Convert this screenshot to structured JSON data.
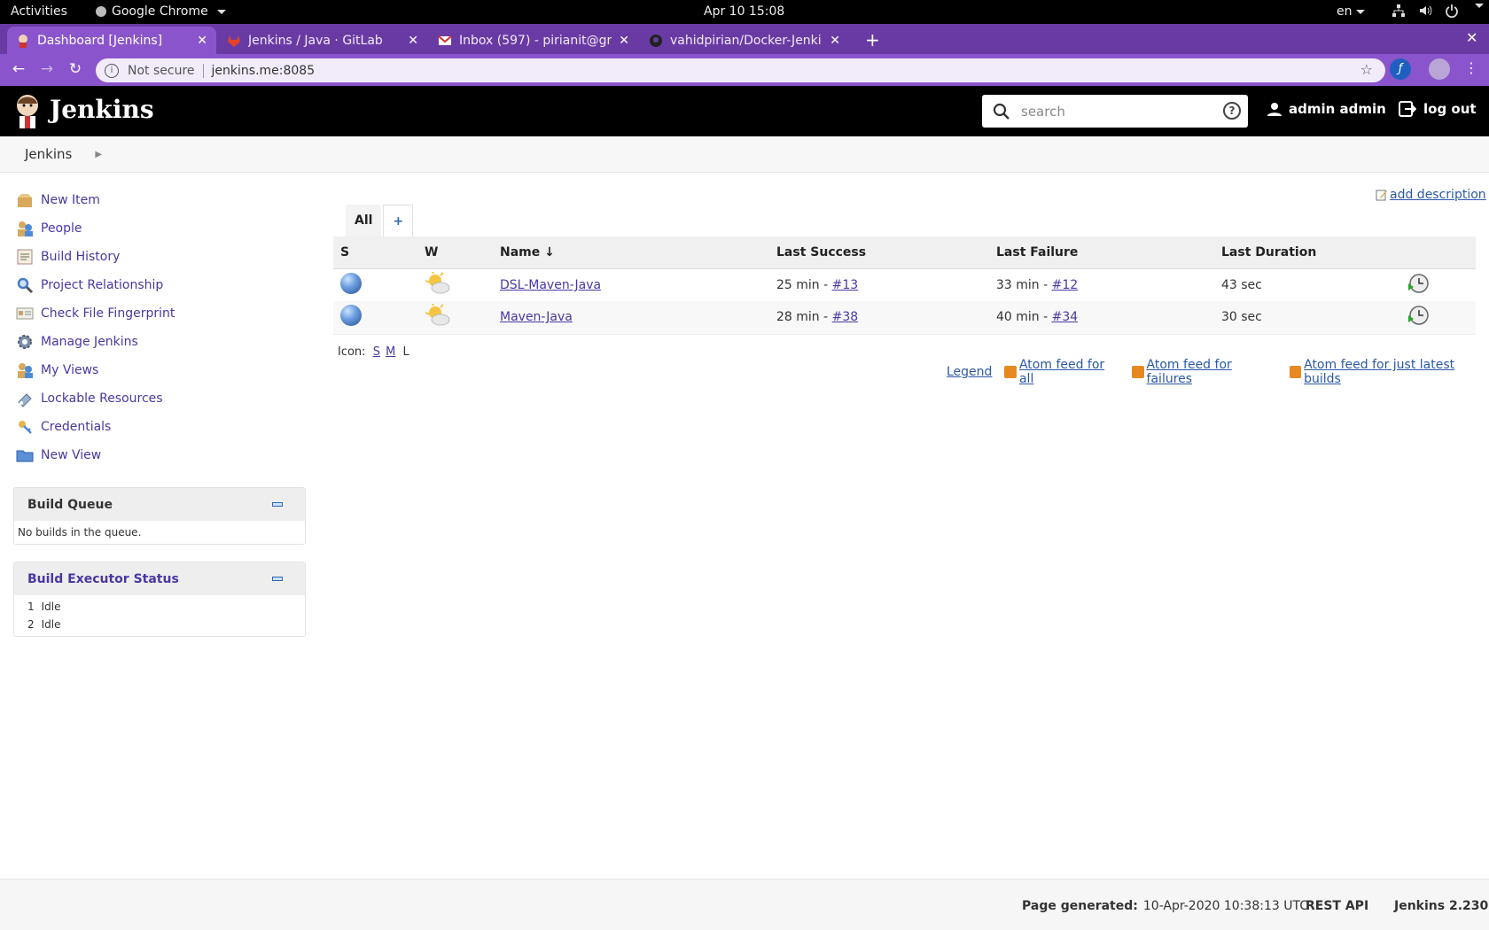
{
  "system_bar": {
    "activities": "Activities",
    "app_name": "Google Chrome",
    "clock": "Apr 10  15:08",
    "language": "en"
  },
  "browser": {
    "tabs": [
      {
        "title": "Dashboard [Jenkins]",
        "favicon": "jenkins-icon",
        "active": true
      },
      {
        "title": "Jenkins / Java · GitLab",
        "favicon": "gitlab-icon",
        "active": false
      },
      {
        "title": "Inbox (597) - pirianit@gm",
        "favicon": "gmail-icon",
        "active": false
      },
      {
        "title": "vahidpirian/Docker-Jenki",
        "favicon": "github-icon",
        "active": false
      }
    ],
    "new_tab": "+",
    "security_label": "Not secure",
    "url": "jenkins.me:8085"
  },
  "jenkins_header": {
    "brand": "Jenkins",
    "search_placeholder": "search",
    "user": "admin admin",
    "logout": "log out"
  },
  "breadcrumb": {
    "root": "Jenkins"
  },
  "side_tasks": [
    {
      "label": "New Item",
      "icon": "new-item-icon"
    },
    {
      "label": "People",
      "icon": "people-icon"
    },
    {
      "label": "Build History",
      "icon": "build-history-icon"
    },
    {
      "label": "Project Relationship",
      "icon": "search-icon"
    },
    {
      "label": "Check File Fingerprint",
      "icon": "fingerprint-icon"
    },
    {
      "label": "Manage Jenkins",
      "icon": "gear-icon"
    },
    {
      "label": "My Views",
      "icon": "people-icon"
    },
    {
      "label": "Lockable Resources",
      "icon": "lock-icon"
    },
    {
      "label": "Credentials",
      "icon": "key-icon"
    },
    {
      "label": "New View",
      "icon": "folder-icon"
    }
  ],
  "build_queue": {
    "title": "Build Queue",
    "empty_message": "No builds in the queue."
  },
  "executor_status": {
    "title": "Build Executor Status",
    "executors": [
      {
        "number": "1",
        "state": "Idle"
      },
      {
        "number": "2",
        "state": "Idle"
      }
    ]
  },
  "main": {
    "add_description": "add description",
    "view_tabs": {
      "all": "All",
      "add": "+"
    },
    "columns": {
      "status": "S",
      "weather": "W",
      "name": "Name",
      "sort_indicator": "↓",
      "last_success": "Last Success",
      "last_failure": "Last Failure",
      "last_duration": "Last Duration"
    },
    "jobs": [
      {
        "name": "DSL-Maven-Java",
        "success_time": "25 min - ",
        "success_build": "#13",
        "failure_time": "33 min - ",
        "failure_build": "#12",
        "duration": "43 sec",
        "status_color": "blue",
        "weather": "partly-sunny"
      },
      {
        "name": "Maven-Java",
        "success_time": "28 min - ",
        "success_build": "#38",
        "failure_time": "40 min - ",
        "failure_build": "#34",
        "duration": "30 sec",
        "status_color": "blue",
        "weather": "partly-sunny"
      }
    ],
    "icon_size": {
      "label": "Icon:",
      "small": "S",
      "medium": "M",
      "large": "L"
    },
    "legend": "Legend",
    "feeds": {
      "all": "Atom feed for all",
      "failures": "Atom feed for failures",
      "latest": "Atom feed for just latest builds"
    }
  },
  "footer": {
    "page_generated_label": "Page generated:",
    "page_generated_value": "10-Apr-2020 10:38:13 UTC",
    "rest_api": "REST API",
    "version": "Jenkins 2.230"
  },
  "colors": {
    "tab_strip": "#6a3aa4",
    "active_tab": "#8a55cc",
    "jenkins_header": "#000000",
    "link": "#4b37a3"
  }
}
